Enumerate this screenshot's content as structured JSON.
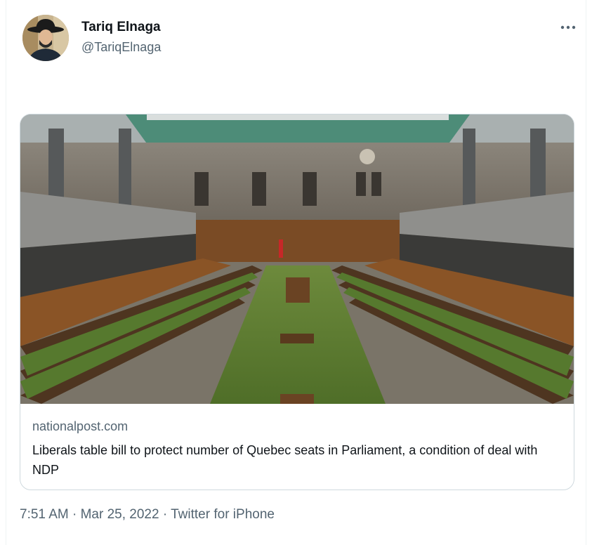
{
  "author": {
    "name": "Tariq Elnaga",
    "handle": "@TariqElnaga"
  },
  "link_card": {
    "domain": "nationalpost.com",
    "title": "Liberals table bill to protect number of Quebec seats in Parliament, a condition of deal with NDP"
  },
  "meta": {
    "time": "7:51 AM",
    "separator": " · ",
    "date": "Mar 25, 2022",
    "source": "Twitter for iPhone"
  },
  "icons": {
    "more": "more-options-icon"
  },
  "colors": {
    "primary_text": "#0f1419",
    "secondary_text": "#536471",
    "border": "#cfd9de"
  }
}
